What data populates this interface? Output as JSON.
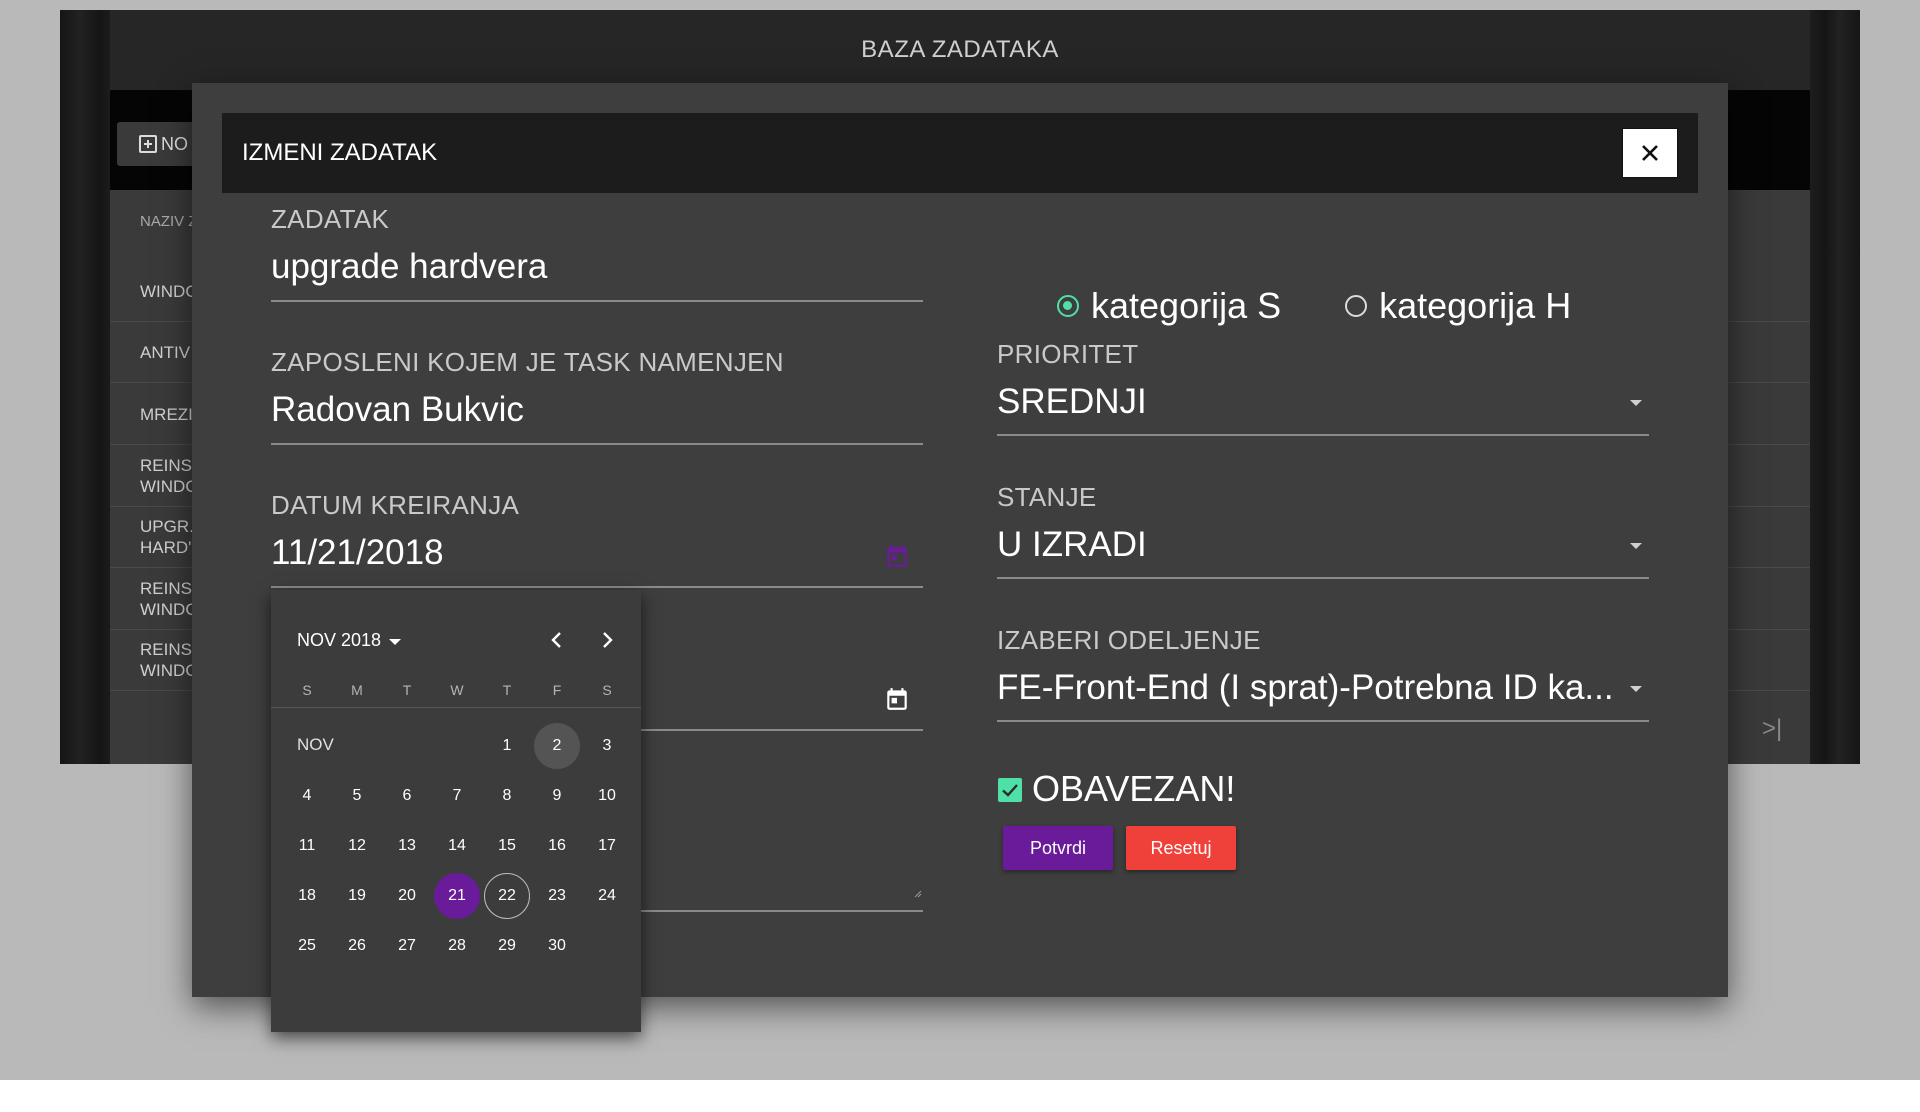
{
  "app": {
    "title": "BAZA ZADATAKA",
    "new_button_label": "NO",
    "table_header": "NAZIV Z",
    "rows": [
      {
        "label": "WINDO"
      },
      {
        "label": "ANTIV"
      },
      {
        "label": "MREZI"
      },
      {
        "label": "REINS\nWINDO"
      },
      {
        "label": "UPGR.\nHARD'"
      },
      {
        "label": "REINS\nWINDO"
      },
      {
        "label": "REINS\nWINDO"
      }
    ],
    "pager_last": ">|"
  },
  "modal": {
    "title": "IZMENI ZADATAK",
    "task": {
      "label": "ZADATAK",
      "value": "upgrade hardvera"
    },
    "assignee": {
      "label": "ZAPOSLENI KOJEM JE TASK NAMENJEN",
      "value": "Radovan Bukvic"
    },
    "created_date": {
      "label": "DATUM KREIRANJA",
      "value": "11/21/2018"
    },
    "category": {
      "options": [
        {
          "label": "kategorija S",
          "checked": true
        },
        {
          "label": "kategorija H",
          "checked": false
        }
      ]
    },
    "priority": {
      "label": "PRIORITET",
      "value": "SREDNJI"
    },
    "status": {
      "label": "STANJE",
      "value": "U IZRADI"
    },
    "department": {
      "label": "IZABERI ODELJENJE",
      "value": "FE-Front-End (I sprat)-Potrebna ID ka..."
    },
    "mandatory": {
      "label": "OBAVEZAN!",
      "checked": true
    },
    "confirm_label": "Potvrdi",
    "reset_label": "Resetuj"
  },
  "datepicker": {
    "header": "NOV 2018",
    "weekdays": [
      "S",
      "M",
      "T",
      "W",
      "T",
      "F",
      "S"
    ],
    "month_label": "NOV",
    "first_weekday": 4,
    "days": 30,
    "hover_day": 2,
    "selected_day": 21,
    "today_day": 22
  },
  "colors": {
    "accent": "#6a1b9a",
    "success": "#4fe0a7",
    "danger": "#f0403a"
  },
  "icons": [
    "add-box-icon",
    "close-icon",
    "calendar-icon",
    "chevron-left-icon",
    "chevron-right-icon",
    "dropdown-arrow-icon",
    "checkbox-checked-icon"
  ]
}
